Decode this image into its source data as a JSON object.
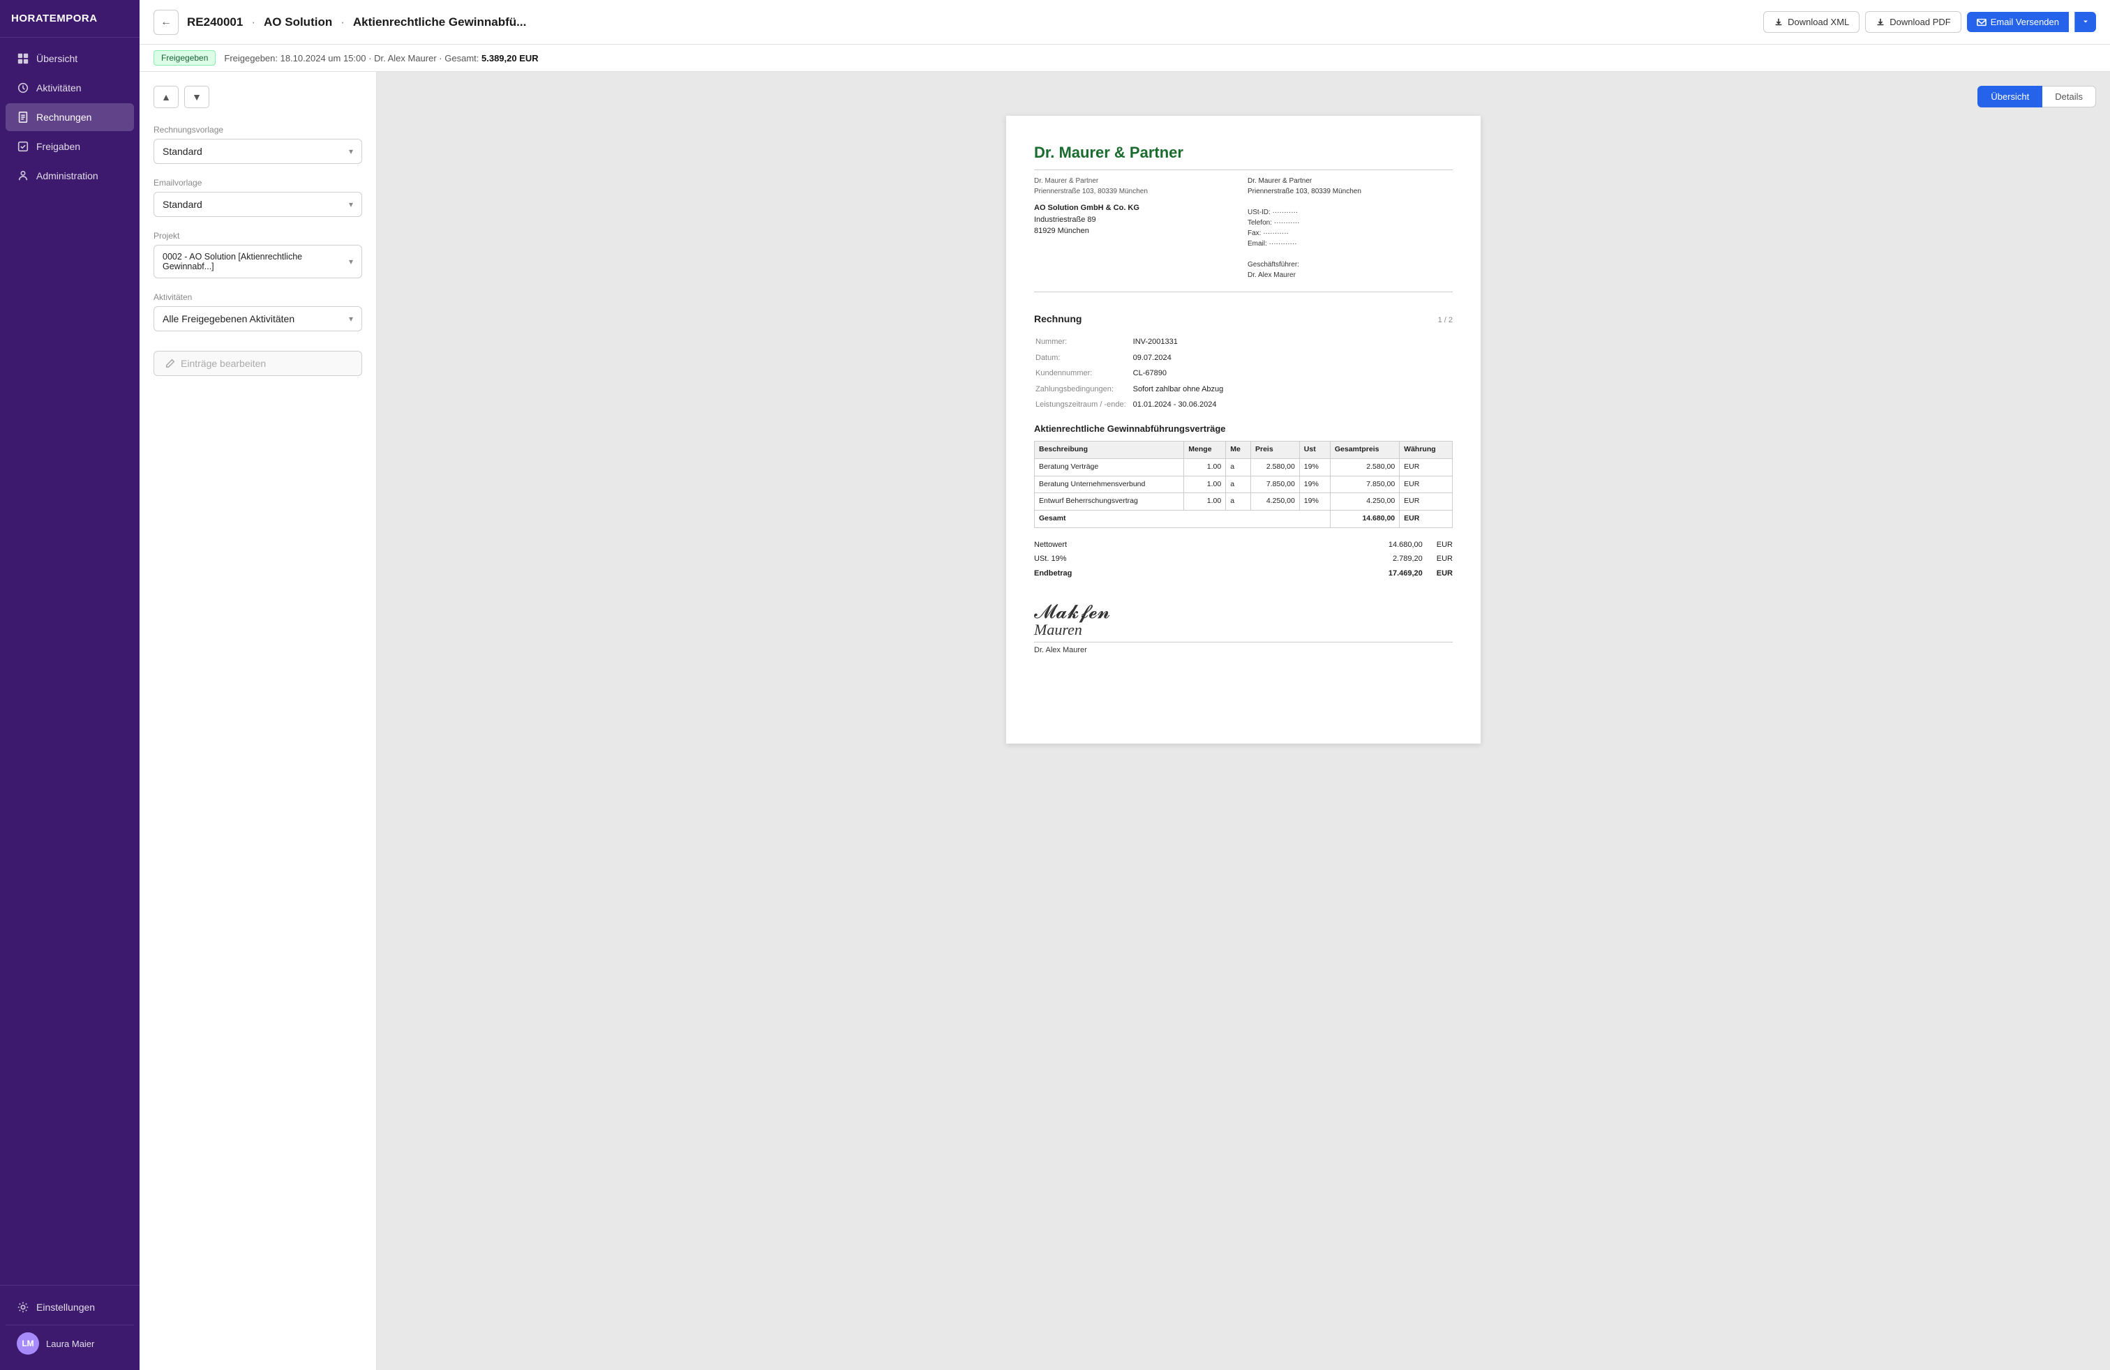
{
  "app": {
    "name": "HORATEMPORA"
  },
  "sidebar": {
    "items": [
      {
        "id": "ubersicht",
        "label": "Übersicht",
        "icon": "grid"
      },
      {
        "id": "aktivitaten",
        "label": "Aktivitäten",
        "icon": "clock"
      },
      {
        "id": "rechnungen",
        "label": "Rechnungen",
        "icon": "invoice",
        "active": true
      },
      {
        "id": "freigaben",
        "label": "Freigaben",
        "icon": "check"
      },
      {
        "id": "administration",
        "label": "Administration",
        "icon": "admin"
      }
    ],
    "settings_label": "Einstellungen",
    "user": {
      "name": "Laura Maier",
      "initials": "LM"
    }
  },
  "topbar": {
    "back_button": "←",
    "invoice_number": "RE240001",
    "dot1": "·",
    "client": "AO Solution",
    "dot2": "·",
    "title": "Aktienrechtliche Gewinnabfü...",
    "btn_download_xml": "Download XML",
    "btn_download_pdf": "Download PDF",
    "btn_email": "Email Versenden"
  },
  "statusbar": {
    "badge": "Freigegeben",
    "text": "Freigegeben: 18.10.2024 um 15:00",
    "dot1": "·",
    "signer": "Dr. Alex Maurer",
    "dot2": "·",
    "total_label": "Gesamt:",
    "total_amount": "5.389,20 EUR"
  },
  "left_panel": {
    "rechnungsvorlage": {
      "label": "Rechnungsvorlage",
      "value": "Standard"
    },
    "emailvorlage": {
      "label": "Emailvorlage",
      "value": "Standard"
    },
    "projekt": {
      "label": "Projekt",
      "value": "0002 - AO Solution [Aktienrechtliche Gewinnabf...]"
    },
    "aktivitaten": {
      "label": "Aktivitäten",
      "value": "Alle Freigegebenen Aktivitäten"
    },
    "btn_edit": "Einträge bearbeiten"
  },
  "invoice": {
    "tabs": [
      {
        "id": "ubersicht",
        "label": "Übersicht",
        "active": true
      },
      {
        "id": "details",
        "label": "Details",
        "active": false
      }
    ],
    "firm_name": "Dr. Maurer & Partner",
    "sender_address_left": "Dr. Maurer & Partner\nPriennerstraße 103, 80339 München",
    "sender_address_right_line1": "Dr. Maurer & Partner",
    "sender_address_right_line2": "Priennerstraße 103, 80339 München",
    "ust_id": "USt-ID: ···········",
    "telefon": "Telefon: ···········",
    "fax": "Fax: ···········",
    "email": "Email: ············",
    "geschäftsführer_label": "Geschäftsführer:",
    "geschäftsführer": "Dr. Alex Maurer",
    "recipient_name": "AO Solution GmbH & Co. KG",
    "recipient_street": "Industriestraße 89",
    "recipient_city": "81929 München",
    "section_title": "Rechnung",
    "page_num": "1 / 2",
    "nummer_label": "Nummer:",
    "nummer": "INV-2001331",
    "datum_label": "Datum:",
    "datum": "09.07.2024",
    "kundennummer_label": "Kundennummer:",
    "kundennummer": "CL-67890",
    "zahlungsbedingungen_label": "Zahlungsbedingungen:",
    "zahlungsbedingungen": "Sofort zahlbar ohne Abzug",
    "leistungszeitraum_label": "Leistungszeitraum / -ende:",
    "leistungszeitraum": "01.01.2024 - 30.06.2024",
    "subtitle": "Aktienrechtliche Gewinnabführungsverträge",
    "table": {
      "headers": [
        "Beschreibung",
        "Menge",
        "Me",
        "Preis",
        "Ust",
        "Gesamtpreis",
        "Währung"
      ],
      "rows": [
        {
          "beschreibung": "Beratung Verträge",
          "menge": "1.00",
          "me": "a",
          "preis": "2.580,00",
          "ust": "19%",
          "gesamtpreis": "2.580,00",
          "wahrung": "EUR"
        },
        {
          "beschreibung": "Beratung Unternehmensverbund",
          "menge": "1.00",
          "me": "a",
          "preis": "7.850,00",
          "ust": "19%",
          "gesamtpreis": "7.850,00",
          "wahrung": "EUR"
        },
        {
          "beschreibung": "Entwurf Beherrschungsvertrag",
          "menge": "1.00",
          "me": "a",
          "preis": "4.250,00",
          "ust": "19%",
          "gesamtpreis": "4.250,00",
          "wahrung": "EUR"
        }
      ],
      "total_label": "Gesamt",
      "total_amount": "14.680,00",
      "total_currency": "EUR"
    },
    "nettowert_label": "Nettowert",
    "nettowert": "14.680,00",
    "nettowert_currency": "EUR",
    "ust_label": "USt.",
    "ust_percent": "19%",
    "ust_amount": "2.789,20",
    "ust_currency": "EUR",
    "endbetrag_label": "Endbetrag",
    "endbetrag": "17.469,20",
    "endbetrag_currency": "EUR",
    "signature_person": "Dr. Alex Maurer"
  }
}
